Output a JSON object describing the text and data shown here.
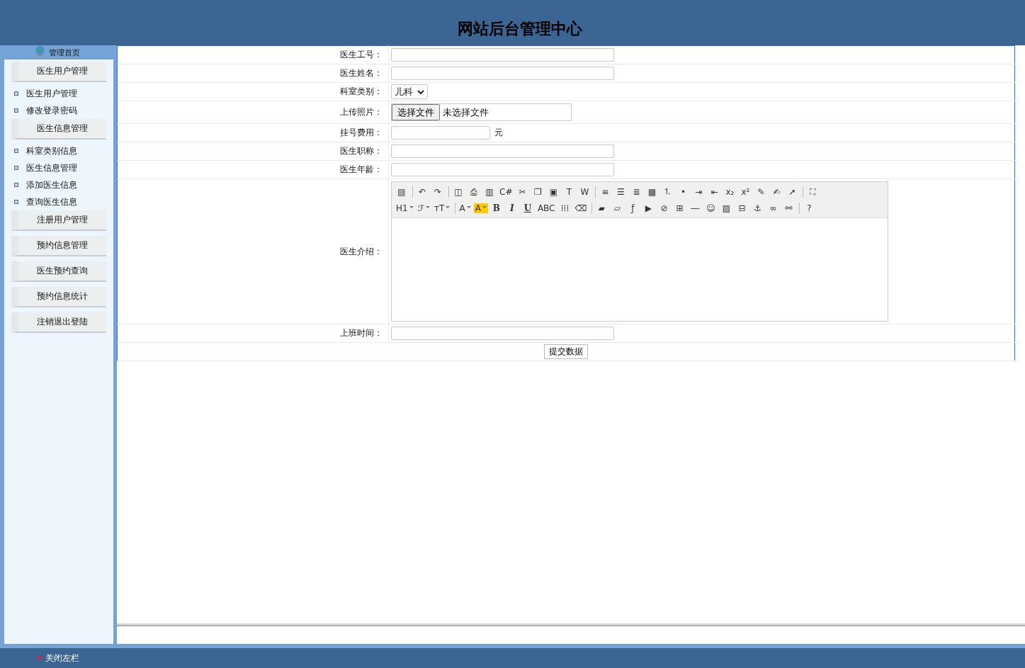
{
  "header": {
    "title": "网站后台管理中心"
  },
  "sidebar": {
    "home": "管理首页",
    "groups": [
      {
        "title": "医生用户管理",
        "items": [
          "医生用户管理",
          "修改登录密码"
        ]
      },
      {
        "title": "医生信息管理",
        "items": [
          "科室类别信息",
          "医生信息管理",
          "添加医生信息",
          "查询医生信息"
        ]
      },
      {
        "title": "注册用户管理"
      },
      {
        "title": "预约信息管理"
      },
      {
        "title": "医生预约查询"
      },
      {
        "title": "预约信息统计"
      },
      {
        "title": "注销退出登陆"
      }
    ]
  },
  "form": {
    "fields": [
      {
        "kind": "text",
        "label": "医生工号："
      },
      {
        "kind": "text",
        "label": "医生姓名："
      },
      {
        "kind": "select",
        "label": "科室类别：",
        "value": "儿科"
      },
      {
        "kind": "file",
        "label": "上传照片：",
        "button": "选择文件",
        "status": "未选择文件"
      },
      {
        "kind": "unit",
        "label": "挂号费用：",
        "unit": "元"
      },
      {
        "kind": "text",
        "label": "医生职称："
      },
      {
        "kind": "text",
        "label": "医生年龄："
      },
      {
        "kind": "editor",
        "label": "医生介绍："
      },
      {
        "kind": "text",
        "label": "上班时间："
      }
    ],
    "submit": "提交数据",
    "editor_toolbar": [
      [
        {
          "kind": "glyph",
          "text": "▤"
        },
        {
          "kind": "sep"
        },
        {
          "kind": "glyph",
          "text": "↶"
        },
        {
          "kind": "glyph",
          "text": "↷"
        },
        {
          "kind": "sep"
        },
        {
          "kind": "glyph",
          "text": "◫"
        },
        {
          "kind": "glyph",
          "text": "⎙"
        },
        {
          "kind": "glyph",
          "text": "▥"
        },
        {
          "kind": "glyph",
          "text": "C#"
        },
        {
          "kind": "glyph",
          "text": "✂"
        },
        {
          "kind": "glyph",
          "text": "❐"
        },
        {
          "kind": "glyph",
          "text": "▣"
        },
        {
          "kind": "glyph",
          "text": "T"
        },
        {
          "kind": "glyph",
          "text": "W"
        },
        {
          "kind": "sep"
        },
        {
          "kind": "glyph",
          "text": "≡"
        },
        {
          "kind": "glyph",
          "text": "☰"
        },
        {
          "kind": "glyph",
          "text": "≣"
        },
        {
          "kind": "glyph",
          "text": "▦"
        },
        {
          "kind": "glyph",
          "text": "⒈"
        },
        {
          "kind": "glyph",
          "text": "•"
        },
        {
          "kind": "glyph",
          "text": "⇥"
        },
        {
          "kind": "glyph",
          "text": "⇤"
        },
        {
          "kind": "glyph",
          "text": "x₂"
        },
        {
          "kind": "glyph",
          "text": "x²"
        },
        {
          "kind": "glyph",
          "text": "✎"
        },
        {
          "kind": "glyph",
          "text": "✍"
        },
        {
          "kind": "glyph",
          "text": "➚"
        },
        {
          "kind": "sep"
        },
        {
          "kind": "glyph",
          "text": "⛶"
        }
      ],
      [
        {
          "kind": "menu",
          "text": "H1"
        },
        {
          "kind": "menu",
          "text": "ℱ"
        },
        {
          "kind": "menu",
          "text": "тT"
        },
        {
          "kind": "sep"
        },
        {
          "kind": "menu",
          "text": "A"
        },
        {
          "kind": "highlight",
          "text": "A"
        },
        {
          "kind": "bold",
          "text": "B"
        },
        {
          "kind": "italic",
          "text": "I"
        },
        {
          "kind": "underline",
          "text": "U"
        },
        {
          "kind": "glyph",
          "text": "ABC"
        },
        {
          "kind": "glyph",
          "text": "⁞⁞⁞"
        },
        {
          "kind": "glyph",
          "text": "⌫"
        },
        {
          "kind": "sep"
        },
        {
          "kind": "glyph",
          "text": "▰"
        },
        {
          "kind": "glyph",
          "text": "▱"
        },
        {
          "kind": "glyph",
          "text": "ƒ"
        },
        {
          "kind": "glyph",
          "text": "▶"
        },
        {
          "kind": "glyph",
          "text": "⊘"
        },
        {
          "kind": "glyph",
          "text": "⊞"
        },
        {
          "kind": "glyph",
          "text": "―"
        },
        {
          "kind": "glyph",
          "text": "☺"
        },
        {
          "kind": "glyph",
          "text": "▨"
        },
        {
          "kind": "glyph",
          "text": "⊟"
        },
        {
          "kind": "glyph",
          "text": "⚓"
        },
        {
          "kind": "glyph",
          "text": "∞"
        },
        {
          "kind": "glyph",
          "text": "⚯"
        },
        {
          "kind": "sep"
        },
        {
          "kind": "glyph",
          "text": "?"
        }
      ]
    ]
  },
  "footer": {
    "toggle": "关闭左栏"
  }
}
